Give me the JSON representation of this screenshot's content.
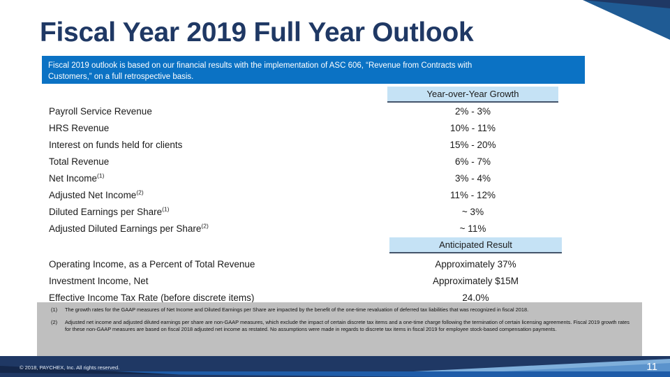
{
  "slide": {
    "title": "Fiscal Year 2019 Full Year Outlook",
    "page_number": "11",
    "copyright": "© 2018,  PAYCHEX,  Inc. All rights  reserved.",
    "accent_colors": {
      "title_navy": "#1F3864",
      "banner_blue": "#0B72C4",
      "header_light_blue": "#C5E2F5",
      "header_rule": "#44546A",
      "footnote_gray": "#BFBFBF",
      "bar_navy": "#1F3864",
      "bar_mid_blue": "#1F5CA8",
      "bar_light_blue": "#7FAFDB"
    }
  },
  "banner": {
    "line1": "Fiscal 2019 outlook is based on our financial results with the implementation  of ASC 606, “Revenue  from  Contracts with",
    "line2": "Customers,”  on a full retrospective  basis."
  },
  "table": {
    "section_growth": {
      "header": "Year-over-Year Growth",
      "rows": [
        {
          "label": "Payroll Service Revenue",
          "footnote": "",
          "value": "2%  - 3%"
        },
        {
          "label": "HRS Revenue",
          "footnote": "",
          "value": "10% - 11%"
        },
        {
          "label": "Interest on funds held for clients",
          "footnote": "",
          "value": "15% - 20%"
        },
        {
          "label": "Total Revenue",
          "footnote": "",
          "value": "6% - 7%"
        },
        {
          "label": "Net Income",
          "footnote": "(1)",
          "value": "3% - 4%"
        },
        {
          "label": "Adjusted Net Income",
          "footnote": "(2)",
          "value": "11% - 12%"
        },
        {
          "label": "Diluted Earnings per Share",
          "footnote": "(1)",
          "value": "~ 3%"
        },
        {
          "label": "Adjusted Diluted Earnings per Share",
          "footnote": "(2)",
          "value": "~ 11%"
        }
      ]
    },
    "section_anticipated": {
      "header": "Anticipated Result",
      "rows": [
        {
          "label": "Operating Income, as a Percent of Total Revenue",
          "footnote": "",
          "value": "Approximately 37%"
        },
        {
          "label": "Investment Income, Net",
          "footnote": "",
          "value": "Approximately $15M"
        },
        {
          "label": "Effective Income Tax Rate (before discrete items)",
          "footnote": "",
          "value": "24.0%"
        }
      ]
    }
  },
  "footnotes": [
    {
      "marker": "(1)",
      "text": "The growth rates for the GAAP  measures of Net Income and Diluted Earnings per Share  are impacted by the benefit of the one-time revaluation of deferred tax liabilities that was recognized  in fiscal 2018."
    },
    {
      "marker": "(2)",
      "text": "Adjusted net income and adjusted diluted earnings per  share are non-GAAP  measures, which  exclude the impact of certain discrete tax items and a one-time charge  following the termination of certain licensing agreements.  Fiscal 2019 growth  rates for these non-GAAP  measures are based on fiscal 2018 adjusted net income as restated.   No assumptions were made in regards  to discrete tax items in  fiscal 2019 for employee stock-based compensation payments."
    }
  ]
}
